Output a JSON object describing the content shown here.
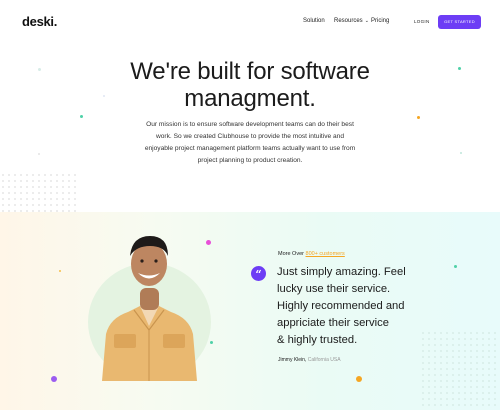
{
  "nav": {
    "logo": "deski.",
    "links": [
      "Solution",
      "Resources",
      "Pricing"
    ],
    "login": "LOGIN",
    "cta": "GET STARTED"
  },
  "hero": {
    "title_line1": "We're built for software",
    "title_line2": "managment.",
    "paragraph_line1": "Our mission is to ensure software development teams can do their best",
    "paragraph_line2": "work. So we created Clubhouse to provide the most intuitive and",
    "paragraph_line3": "enjoyable project management platform teams actually want to use  from",
    "paragraph_line4": "project planning to product creation."
  },
  "testimonial": {
    "more_over_prefix": "More Over ",
    "more_over_link": "800+ customers",
    "quote_line1": "Just simply amazing. Feel",
    "quote_line2": "lucky use their service.",
    "quote_line3": "Highly recommended and",
    "quote_line4": "appriciate their service",
    "quote_line5": "& highly trusted.",
    "author_name": "Jimmy Klein,",
    "author_location": " California USA",
    "quote_mark": "“"
  },
  "colors": {
    "accent": "#6d3df5",
    "link": "#f5a623",
    "portrait_bg": "#e4f3e1"
  }
}
